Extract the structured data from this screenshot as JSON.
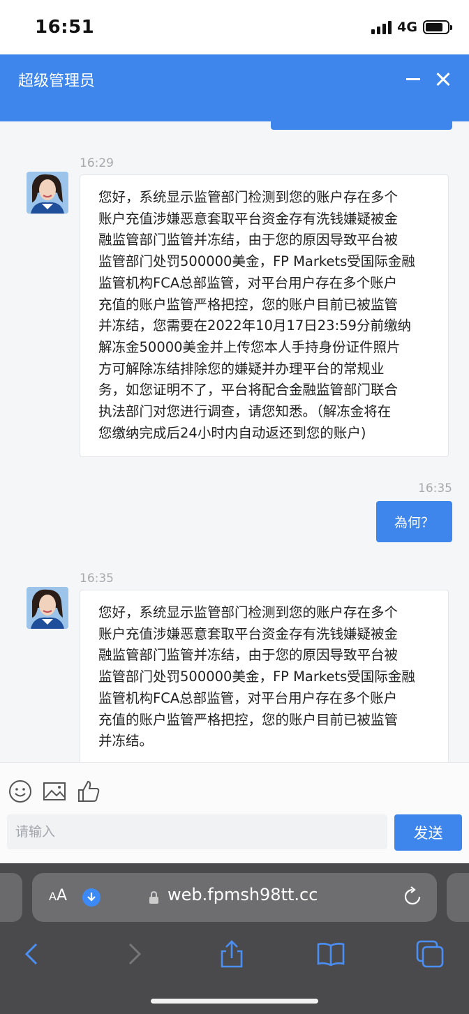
{
  "status_bar": {
    "time": "16:51",
    "network": "4G",
    "battery_level": 0.8
  },
  "header": {
    "title": "超级管理员"
  },
  "messages": [
    {
      "direction": "in",
      "time": "16:29",
      "lines": [
        "您好，系统显示监管部门检测到您的账户存在多个",
        "账户充值涉嫌恶意套取平台资金存有洗钱嫌疑被金",
        "融监管部门监管并冻结，由于您的原因导致平台被",
        "监管部门处罚500000美金，FP Markets受国际金融",
        "监管机构FCA总部监管，对平台用户存在多个账户",
        "充值的账户监管严格把控，您的账户目前已被监管",
        "并冻结，您需要在2022年10月17日23:59分前缴纳",
        "解冻金50000美金并上传您本人手持身份证件照片",
        "方可解除冻结排除您的嫌疑并办理平台的常规业",
        "务，如您证明不了，平台将配合金融监管部门联合",
        "执法部门对您进行调查，请您知悉。（解冻金将在",
        "您缴纳完成后24小时内自动返还到您的账户)"
      ]
    },
    {
      "direction": "out",
      "time": "16:35",
      "text": "為何？"
    },
    {
      "direction": "in",
      "time": "16:35",
      "lines": [
        "您好，系统显示监管部门检测到您的账户存在多个",
        "账户充值涉嫌恶意套取平台资金存有洗钱嫌疑被金",
        "融监管部门监管并冻结，由于您的原因导致平台被",
        "监管部门处罚500000美金，FP Markets受国际金融",
        "监管机构FCA总部监管，对平台用户存在多个账户",
        "充值的账户监管严格把控，您的账户目前已被监管",
        "并冻结。"
      ]
    }
  ],
  "toolbar": {
    "icons": [
      "emoji-icon",
      "image-icon",
      "thumbs-up-icon"
    ],
    "input_placeholder": "请输入",
    "input_value": "",
    "send_label": "发送"
  },
  "browser": {
    "text_size_label_small": "A",
    "text_size_label_large": "A",
    "url": "web.fpmsh98tt.cc",
    "nav_icons": [
      "back-icon",
      "forward-icon",
      "share-icon",
      "bookmarks-icon",
      "tabs-icon"
    ]
  },
  "colors": {
    "accent": "#3f86ec",
    "browser_bg": "#4a4a4c"
  }
}
